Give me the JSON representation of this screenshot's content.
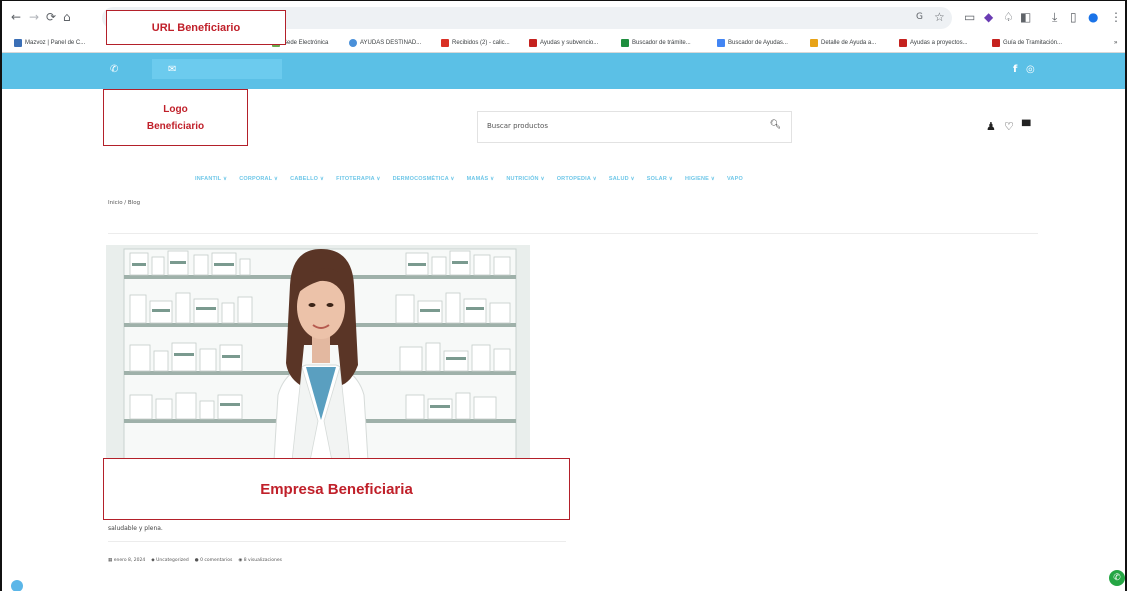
{
  "browser": {
    "bookmarks": [
      {
        "label": "Mazvoz | Panel de C...",
        "color": "#3b6fb6"
      },
      {
        "label": "Sede Electrónica",
        "color": "#6aa84f"
      },
      {
        "label": "AYUDAS DESTINAD...",
        "color": "#4a90d9"
      },
      {
        "label": "Recibidos (2) - calic...",
        "color": "#d93025"
      },
      {
        "label": "Ayudas y subvencio...",
        "color": "#c5221f"
      },
      {
        "label": "Buscador de trámite...",
        "color": "#1e8e3e"
      },
      {
        "label": "Buscador de Ayudas...",
        "color": "#4285f4"
      },
      {
        "label": "Detalle de Ayuda a...",
        "color": "#e8a317"
      },
      {
        "label": "Ayudas a proyectos...",
        "color": "#c5221f"
      },
      {
        "label": "Guía de Tramitación...",
        "color": "#c5221f"
      }
    ]
  },
  "annotations": {
    "url": "URL Beneficiario",
    "logo_line1": "Logo",
    "logo_line2": "Beneficiario",
    "company": "Empresa Beneficiaria"
  },
  "header": {
    "search_placeholder": "Buscar productos"
  },
  "menu": [
    "INFANTIL ∨",
    "CORPORAL ∨",
    "CABELLO ∨",
    "FITOTERAPIA ∨",
    "DERMOCOSMÉTICA ∨",
    "MAMÁS ∨",
    "NUTRICIÓN ∨",
    "ORTOPEDIA ∨",
    "SALUD ∨",
    "SOLAR ∨",
    "HIGIENE ∨",
    "VAPO"
  ],
  "breadcrumb": "Inicio / Blog",
  "post": {
    "excerpt": "saludable y plena.",
    "date": "enero 8, 2024",
    "category": "Uncategorized",
    "comments": "0 comentarios",
    "views": "8 visualizaciones"
  },
  "colors": {
    "topbar": "#5bc0e6",
    "menu": "#6fc7e8",
    "annotation": "#c0202a"
  }
}
